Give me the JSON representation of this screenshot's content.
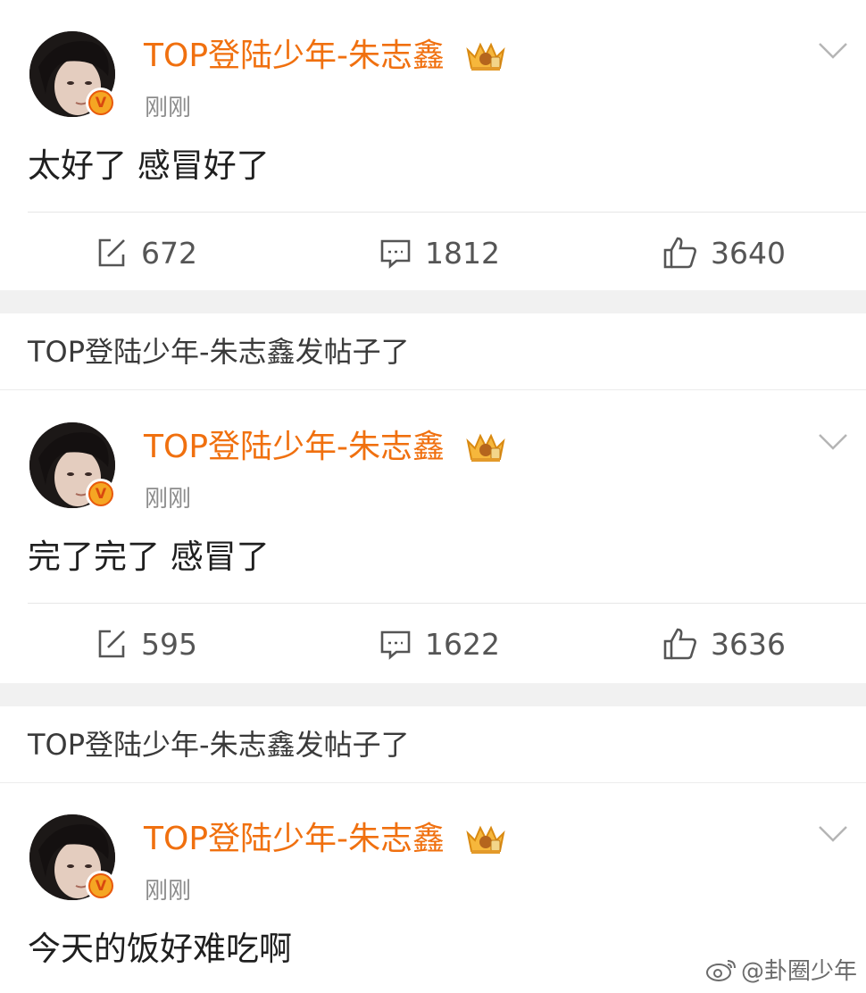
{
  "posts": [
    {
      "username": "TOP登陆少年-朱志鑫",
      "time": "刚刚",
      "verified_badge": "V",
      "content": "太好了 感冒好了",
      "share_count": "672",
      "comment_count": "1812",
      "like_count": "3640"
    },
    {
      "username": "TOP登陆少年-朱志鑫",
      "time": "刚刚",
      "verified_badge": "V",
      "content": "完了完了 感冒了",
      "share_count": "595",
      "comment_count": "1622",
      "like_count": "3636"
    },
    {
      "username": "TOP登陆少年-朱志鑫",
      "time": "刚刚",
      "verified_badge": "V",
      "content": "今天的饭好难吃啊"
    }
  ],
  "notices": [
    "TOP登陆少年-朱志鑫发帖子了",
    "TOP登陆少年-朱志鑫发帖子了"
  ],
  "watermark": "@卦圈少年",
  "icons": {
    "share": "share-icon",
    "comment": "comment-icon",
    "like": "thumbs-up-icon",
    "more": "chevron-down-icon",
    "crown": "crown-badge-icon"
  },
  "colors": {
    "username": "#f0700f",
    "time": "#8c8c8c",
    "separator": "#f1f1f1"
  }
}
